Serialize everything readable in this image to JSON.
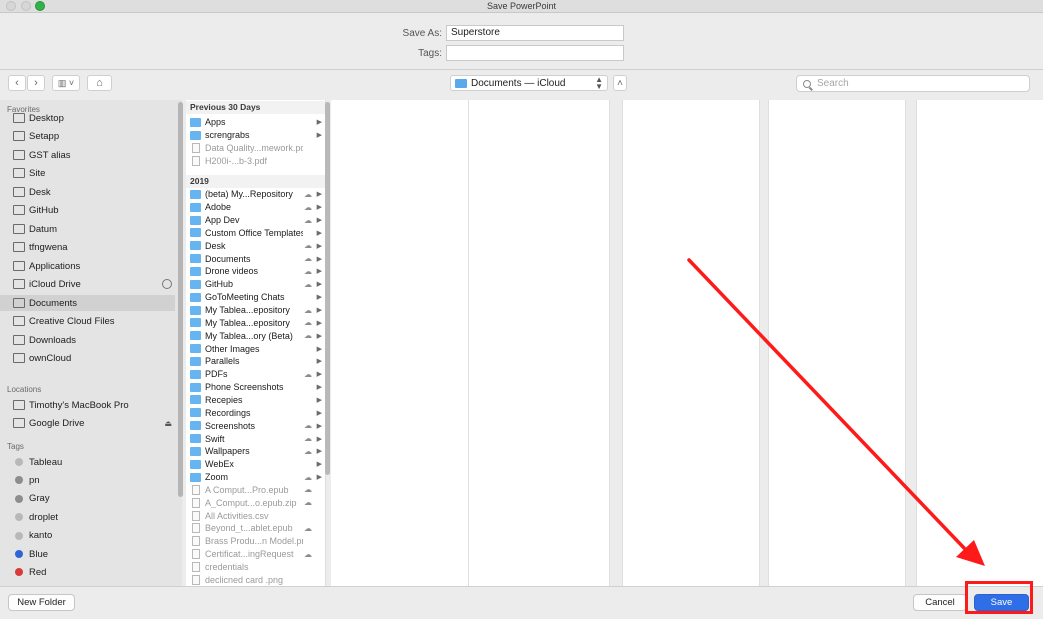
{
  "window": {
    "title": "Save PowerPoint"
  },
  "form": {
    "save_as_label": "Save As:",
    "save_as_value": "Superstore",
    "tags_label": "Tags:",
    "tags_value": ""
  },
  "toolbar": {
    "back_label": "‹",
    "forward_label": "›",
    "view_label": "▥ ˅",
    "newfolder_icon_label": "⌂",
    "location_label": "Documents — iCloud",
    "expand_label": "˄",
    "search_placeholder": "Search"
  },
  "sidebar": {
    "favorites_header": "Favorites",
    "favorites": [
      "Desktop",
      "Setapp",
      "GST alias",
      "Site",
      "Desk",
      "GitHub",
      "Datum",
      "tfngwena",
      "Applications",
      "iCloud Drive",
      "Documents",
      "Creative Cloud Files",
      "Downloads",
      "ownCloud"
    ],
    "selected": "Documents",
    "locations_header": "Locations",
    "locations": [
      "Timothy's MacBook Pro",
      "Google Drive"
    ],
    "tags_header": "Tags",
    "tags": [
      {
        "name": "Tableau",
        "color": "#b8b8b8"
      },
      {
        "name": "pn",
        "color": "#8d8d8d"
      },
      {
        "name": "Gray",
        "color": "#8d8d8d"
      },
      {
        "name": "droplet",
        "color": "#b8b8b8"
      },
      {
        "name": "kanto",
        "color": "#b8b8b8"
      },
      {
        "name": "Blue",
        "color": "#2f63d6"
      },
      {
        "name": "Red",
        "color": "#d93a3a"
      }
    ]
  },
  "browser": {
    "group1_header": "Previous 30 Days",
    "group1": [
      {
        "name": "Apps",
        "type": "folder",
        "cloud": false,
        "dim": false
      },
      {
        "name": "screngrabs",
        "type": "folder",
        "cloud": false,
        "dim": false
      },
      {
        "name": "Data Quality...mework.pdf",
        "type": "file",
        "cloud": false,
        "dim": true
      },
      {
        "name": "H200i-...b-3.pdf",
        "type": "file",
        "cloud": false,
        "dim": true
      }
    ],
    "group2_header": "2019",
    "group2": [
      {
        "name": "(beta) My...Repository",
        "type": "folder",
        "cloud": true,
        "dim": false
      },
      {
        "name": "Adobe",
        "type": "folder",
        "cloud": true,
        "dim": false
      },
      {
        "name": "App Dev",
        "type": "folder",
        "cloud": true,
        "dim": false
      },
      {
        "name": "Custom Office Templates",
        "type": "folder",
        "cloud": false,
        "dim": false
      },
      {
        "name": "Desk",
        "type": "folder",
        "cloud": true,
        "dim": false
      },
      {
        "name": "Documents",
        "type": "folder",
        "cloud": true,
        "dim": false
      },
      {
        "name": "Drone videos",
        "type": "folder",
        "cloud": true,
        "dim": false
      },
      {
        "name": "GitHub",
        "type": "folder",
        "cloud": true,
        "dim": false
      },
      {
        "name": "GoToMeeting Chats",
        "type": "folder",
        "cloud": false,
        "dim": false
      },
      {
        "name": "My Tablea...epository",
        "type": "folder",
        "cloud": true,
        "dim": false
      },
      {
        "name": "My Tablea...epository",
        "type": "folder",
        "cloud": true,
        "dim": false
      },
      {
        "name": "My Tablea...ory (Beta)",
        "type": "folder",
        "cloud": true,
        "dim": false
      },
      {
        "name": "Other Images",
        "type": "folder",
        "cloud": false,
        "dim": false
      },
      {
        "name": "Parallels",
        "type": "folder",
        "cloud": false,
        "dim": false
      },
      {
        "name": "PDFs",
        "type": "folder",
        "cloud": true,
        "dim": false
      },
      {
        "name": "Phone Screenshots",
        "type": "folder",
        "cloud": false,
        "dim": false
      },
      {
        "name": "Recepies",
        "type": "folder",
        "cloud": false,
        "dim": false
      },
      {
        "name": "Recordings",
        "type": "folder",
        "cloud": false,
        "dim": false
      },
      {
        "name": "Screenshots",
        "type": "folder",
        "cloud": true,
        "dim": false
      },
      {
        "name": "Swift",
        "type": "folder",
        "cloud": true,
        "dim": false
      },
      {
        "name": "Wallpapers",
        "type": "folder",
        "cloud": true,
        "dim": false
      },
      {
        "name": "WebEx",
        "type": "folder",
        "cloud": false,
        "dim": false
      },
      {
        "name": "Zoom",
        "type": "folder",
        "cloud": true,
        "dim": false
      },
      {
        "name": "A Comput...Pro.epub",
        "type": "file",
        "cloud": true,
        "dim": true
      },
      {
        "name": "A_Comput...o.epub.zip",
        "type": "file",
        "cloud": true,
        "dim": true
      },
      {
        "name": "All Activities.csv",
        "type": "file",
        "cloud": false,
        "dim": true
      },
      {
        "name": "Beyond_t...ablet.epub",
        "type": "file",
        "cloud": true,
        "dim": true
      },
      {
        "name": "Brass Produ...n Model.png",
        "type": "file",
        "cloud": false,
        "dim": true
      },
      {
        "name": "Certificat...ingRequest",
        "type": "file",
        "cloud": true,
        "dim": true
      },
      {
        "name": "credentials",
        "type": "file",
        "cloud": false,
        "dim": true
      },
      {
        "name": "declicned card .png",
        "type": "file",
        "cloud": false,
        "dim": true
      }
    ]
  },
  "footer": {
    "new_folder_label": "New Folder",
    "cancel_label": "Cancel",
    "save_label": "Save"
  },
  "colors": {
    "accent": "#2f6ee6",
    "annotation": "#ff1a1a"
  }
}
